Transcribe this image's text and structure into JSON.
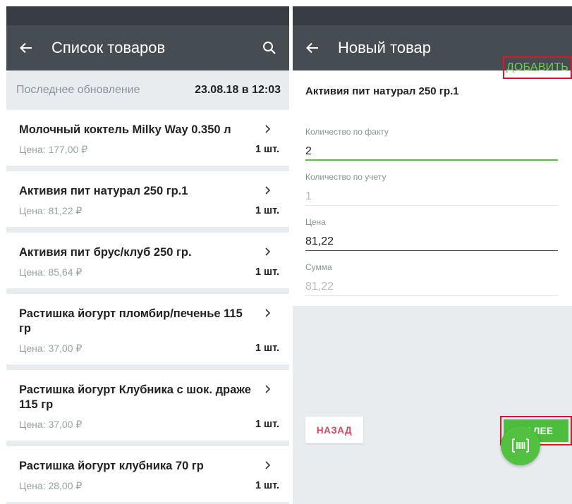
{
  "left": {
    "title": "Список товаров",
    "icons": {
      "back": "arrow-left-icon",
      "search": "search-icon",
      "chevron": "chevron-right-icon"
    },
    "last_update": {
      "label": "Последнее обновление",
      "value": "23.08.18 в 12:03"
    },
    "items": [
      {
        "name": "Молочный коктель Milky Way 0.350 л",
        "price": "Цена: 177,00 ₽",
        "qty": "1 шт."
      },
      {
        "name": "Активия пит натурал 250 гр.1",
        "price": "Цена: 81,22 ₽",
        "qty": "1 шт."
      },
      {
        "name": "Активия пит брус/клуб 250 гр.",
        "price": "Цена: 85,64 ₽",
        "qty": "1 шт."
      },
      {
        "name": "Растишка йогурт пломбир/печенье 115 гр",
        "price": "Цена: 37,00 ₽",
        "qty": "1 шт."
      },
      {
        "name": "Растишка йогурт Клубника с шок. драже 115 гр",
        "price": "Цена: 37,00 ₽",
        "qty": "1 шт."
      },
      {
        "name": "Растишка йогурт клубника 70 гр",
        "price": "Цена: 28,00 ₽",
        "qty": "1 шт."
      }
    ]
  },
  "right": {
    "title": "Новый товар",
    "add_action": "ДОБАВИТЬ",
    "product_name": "Активия пит натурал 250 гр.1",
    "fields": [
      {
        "label": "Количество по факту",
        "value": "2"
      },
      {
        "label": "Количество по учету",
        "value": "1"
      },
      {
        "label": "Цена",
        "value": "81,22"
      },
      {
        "label": "Сумма",
        "value": "81,22"
      }
    ],
    "back_button": "НАЗАД",
    "next_button": "ДАЛЕЕ",
    "fab_icon": "barcode-scan-icon"
  },
  "colors": {
    "appbar": "#454c52",
    "statusbar": "#373d42",
    "accent_green": "#4cbd3c",
    "highlight_red": "#e0152b",
    "back_button_text": "#d9465e"
  }
}
